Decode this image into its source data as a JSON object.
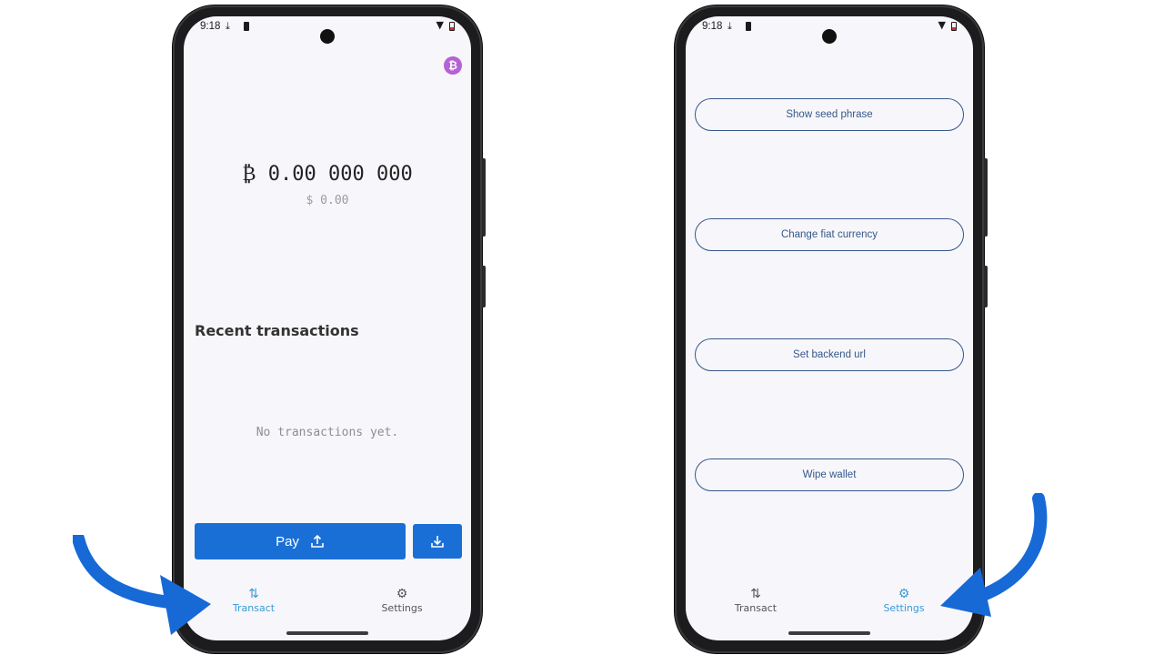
{
  "status": {
    "time": "9:18"
  },
  "left_screen": {
    "balance": "₿ 0.00 000 000",
    "fiat_balance": "$ 0.00",
    "recent_title": "Recent transactions",
    "empty_text": "No transactions yet.",
    "pay_label": "Pay",
    "nav": [
      {
        "label": "Transact",
        "icon": "transact-icon",
        "active": true
      },
      {
        "label": "Settings",
        "icon": "gear-icon",
        "active": false
      }
    ]
  },
  "right_screen": {
    "buttons": [
      {
        "label": "Show seed phrase"
      },
      {
        "label": "Change fiat currency"
      },
      {
        "label": "Set backend url"
      },
      {
        "label": "Wipe wallet"
      }
    ],
    "nav": [
      {
        "label": "Transact",
        "icon": "transact-icon",
        "active": false
      },
      {
        "label": "Settings",
        "icon": "gear-icon",
        "active": true
      }
    ]
  },
  "colors": {
    "accent": "#1a6fd6",
    "nav_active": "#3b9ad6",
    "btc_badge": "#b562d4",
    "outline_button": "#36578a",
    "annotation_arrow": "#1769d6"
  }
}
